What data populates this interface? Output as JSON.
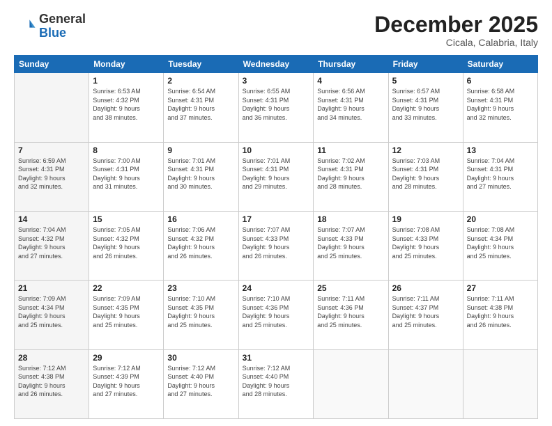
{
  "header": {
    "logo_general": "General",
    "logo_blue": "Blue",
    "month_title": "December 2025",
    "location": "Cicala, Calabria, Italy"
  },
  "columns": [
    "Sunday",
    "Monday",
    "Tuesday",
    "Wednesday",
    "Thursday",
    "Friday",
    "Saturday"
  ],
  "weeks": [
    [
      {
        "day": "",
        "info": ""
      },
      {
        "day": "1",
        "info": "Sunrise: 6:53 AM\nSunset: 4:32 PM\nDaylight: 9 hours\nand 38 minutes."
      },
      {
        "day": "2",
        "info": "Sunrise: 6:54 AM\nSunset: 4:31 PM\nDaylight: 9 hours\nand 37 minutes."
      },
      {
        "day": "3",
        "info": "Sunrise: 6:55 AM\nSunset: 4:31 PM\nDaylight: 9 hours\nand 36 minutes."
      },
      {
        "day": "4",
        "info": "Sunrise: 6:56 AM\nSunset: 4:31 PM\nDaylight: 9 hours\nand 34 minutes."
      },
      {
        "day": "5",
        "info": "Sunrise: 6:57 AM\nSunset: 4:31 PM\nDaylight: 9 hours\nand 33 minutes."
      },
      {
        "day": "6",
        "info": "Sunrise: 6:58 AM\nSunset: 4:31 PM\nDaylight: 9 hours\nand 32 minutes."
      }
    ],
    [
      {
        "day": "7",
        "info": "Sunrise: 6:59 AM\nSunset: 4:31 PM\nDaylight: 9 hours\nand 32 minutes."
      },
      {
        "day": "8",
        "info": "Sunrise: 7:00 AM\nSunset: 4:31 PM\nDaylight: 9 hours\nand 31 minutes."
      },
      {
        "day": "9",
        "info": "Sunrise: 7:01 AM\nSunset: 4:31 PM\nDaylight: 9 hours\nand 30 minutes."
      },
      {
        "day": "10",
        "info": "Sunrise: 7:01 AM\nSunset: 4:31 PM\nDaylight: 9 hours\nand 29 minutes."
      },
      {
        "day": "11",
        "info": "Sunrise: 7:02 AM\nSunset: 4:31 PM\nDaylight: 9 hours\nand 28 minutes."
      },
      {
        "day": "12",
        "info": "Sunrise: 7:03 AM\nSunset: 4:31 PM\nDaylight: 9 hours\nand 28 minutes."
      },
      {
        "day": "13",
        "info": "Sunrise: 7:04 AM\nSunset: 4:31 PM\nDaylight: 9 hours\nand 27 minutes."
      }
    ],
    [
      {
        "day": "14",
        "info": "Sunrise: 7:04 AM\nSunset: 4:32 PM\nDaylight: 9 hours\nand 27 minutes."
      },
      {
        "day": "15",
        "info": "Sunrise: 7:05 AM\nSunset: 4:32 PM\nDaylight: 9 hours\nand 26 minutes."
      },
      {
        "day": "16",
        "info": "Sunrise: 7:06 AM\nSunset: 4:32 PM\nDaylight: 9 hours\nand 26 minutes."
      },
      {
        "day": "17",
        "info": "Sunrise: 7:07 AM\nSunset: 4:33 PM\nDaylight: 9 hours\nand 26 minutes."
      },
      {
        "day": "18",
        "info": "Sunrise: 7:07 AM\nSunset: 4:33 PM\nDaylight: 9 hours\nand 25 minutes."
      },
      {
        "day": "19",
        "info": "Sunrise: 7:08 AM\nSunset: 4:33 PM\nDaylight: 9 hours\nand 25 minutes."
      },
      {
        "day": "20",
        "info": "Sunrise: 7:08 AM\nSunset: 4:34 PM\nDaylight: 9 hours\nand 25 minutes."
      }
    ],
    [
      {
        "day": "21",
        "info": "Sunrise: 7:09 AM\nSunset: 4:34 PM\nDaylight: 9 hours\nand 25 minutes."
      },
      {
        "day": "22",
        "info": "Sunrise: 7:09 AM\nSunset: 4:35 PM\nDaylight: 9 hours\nand 25 minutes."
      },
      {
        "day": "23",
        "info": "Sunrise: 7:10 AM\nSunset: 4:35 PM\nDaylight: 9 hours\nand 25 minutes."
      },
      {
        "day": "24",
        "info": "Sunrise: 7:10 AM\nSunset: 4:36 PM\nDaylight: 9 hours\nand 25 minutes."
      },
      {
        "day": "25",
        "info": "Sunrise: 7:11 AM\nSunset: 4:36 PM\nDaylight: 9 hours\nand 25 minutes."
      },
      {
        "day": "26",
        "info": "Sunrise: 7:11 AM\nSunset: 4:37 PM\nDaylight: 9 hours\nand 25 minutes."
      },
      {
        "day": "27",
        "info": "Sunrise: 7:11 AM\nSunset: 4:38 PM\nDaylight: 9 hours\nand 26 minutes."
      }
    ],
    [
      {
        "day": "28",
        "info": "Sunrise: 7:12 AM\nSunset: 4:38 PM\nDaylight: 9 hours\nand 26 minutes."
      },
      {
        "day": "29",
        "info": "Sunrise: 7:12 AM\nSunset: 4:39 PM\nDaylight: 9 hours\nand 27 minutes."
      },
      {
        "day": "30",
        "info": "Sunrise: 7:12 AM\nSunset: 4:40 PM\nDaylight: 9 hours\nand 27 minutes."
      },
      {
        "day": "31",
        "info": "Sunrise: 7:12 AM\nSunset: 4:40 PM\nDaylight: 9 hours\nand 28 minutes."
      },
      {
        "day": "",
        "info": ""
      },
      {
        "day": "",
        "info": ""
      },
      {
        "day": "",
        "info": ""
      }
    ]
  ]
}
